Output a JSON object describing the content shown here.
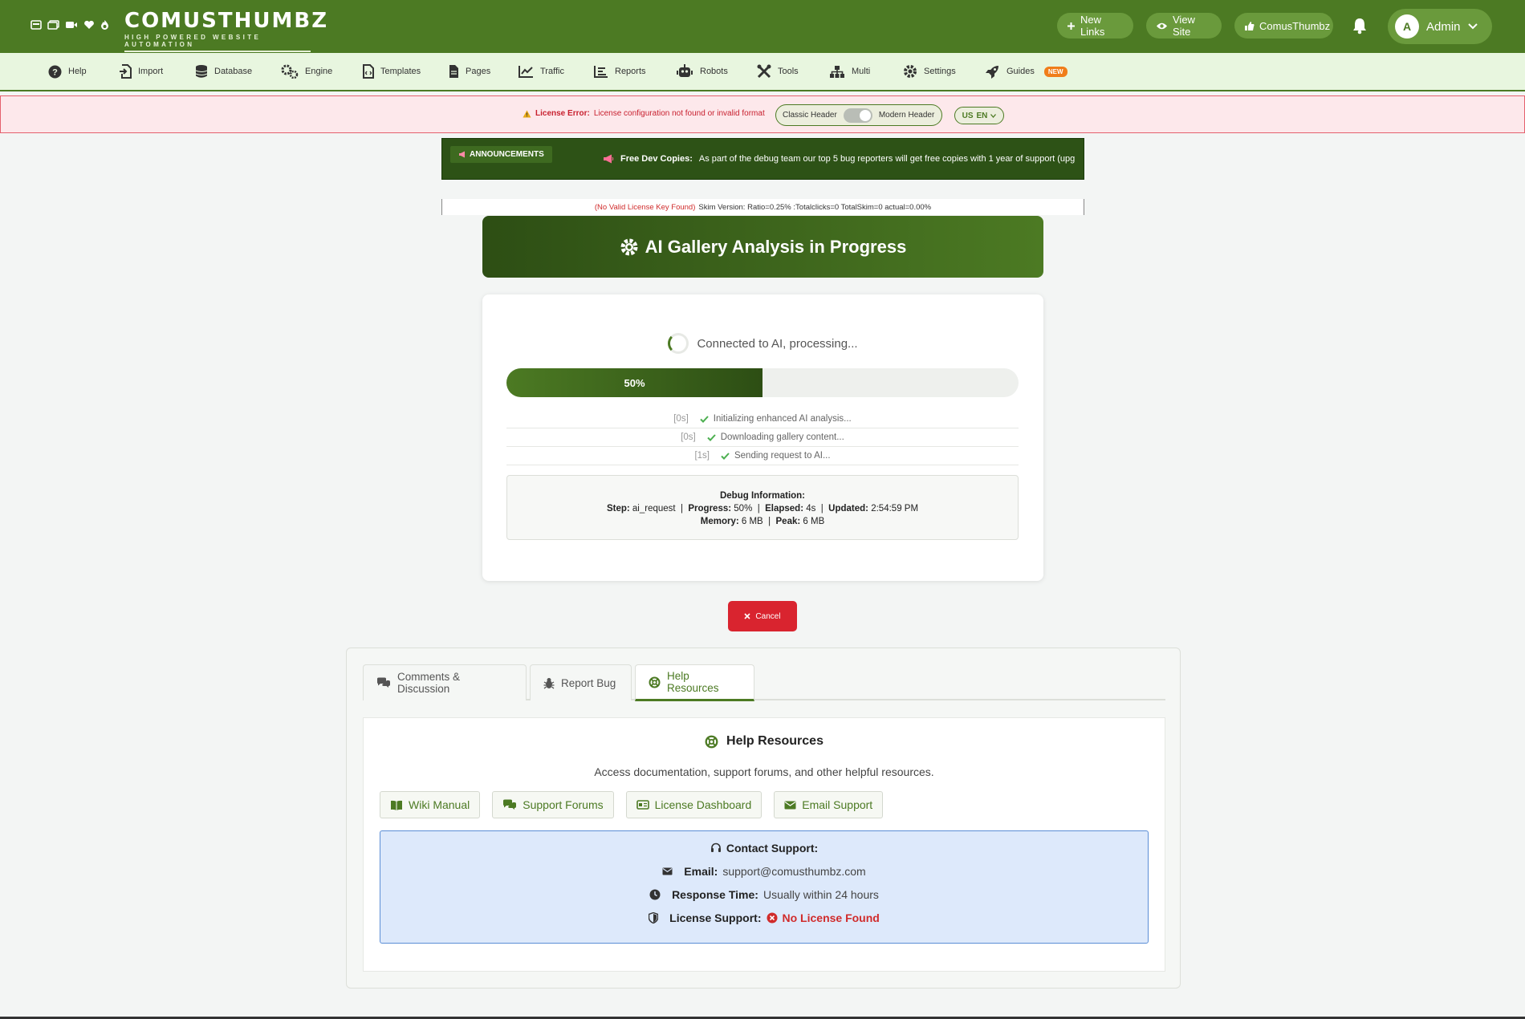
{
  "header": {
    "logo_title": "COMUSTHUMBZ",
    "logo_subtitle": "HIGH POWERED WEBSITE AUTOMATION",
    "new_links": "New Links",
    "view_site": "View Site",
    "comusthumbz": "ComusThumbz",
    "admin": "Admin",
    "avatar_letter": "A"
  },
  "nav": {
    "items": [
      {
        "label": "Help",
        "icon": "question-circle-icon"
      },
      {
        "label": "Import",
        "icon": "file-import-icon"
      },
      {
        "label": "Database",
        "icon": "database-icon"
      },
      {
        "label": "Engine",
        "icon": "gears-icon"
      },
      {
        "label": "Templates",
        "icon": "file-code-icon"
      },
      {
        "label": "Pages",
        "icon": "file-icon"
      },
      {
        "label": "Traffic",
        "icon": "line-chart-icon"
      },
      {
        "label": "Reports",
        "icon": "list-chart-icon"
      },
      {
        "label": "Robots",
        "icon": "robot-icon"
      },
      {
        "label": "Tools",
        "icon": "tools-icon"
      },
      {
        "label": "Multi",
        "icon": "sitemap-icon"
      },
      {
        "label": "Settings",
        "icon": "cog-icon"
      },
      {
        "label": "Guides",
        "icon": "rocket-icon"
      }
    ],
    "guides_badge": "NEW"
  },
  "license": {
    "label": "License Error:",
    "message": "License configuration not found or invalid format",
    "classic": "Classic Header",
    "modern": "Modern Header",
    "lang": "EN",
    "flag": "US"
  },
  "announcement": {
    "badge": "ANNOUNCEMENTS",
    "title": "Free Dev Copies:",
    "text": "As part of the debug team our top 5 bug reporters will get free copies with 1 year of support (upg"
  },
  "skim": {
    "warning": "(No Valid License Key Found)",
    "text": "Skim Version: Ratio=0.25% :Totalclicks=0 TotalSkim=0 actual=0.00%"
  },
  "analysis": {
    "title": "AI Gallery Analysis in Progress",
    "status": "Connected to AI, processing...",
    "progress": 50,
    "progress_label": "50%",
    "log": [
      {
        "time": "[0s]",
        "text": "Initializing enhanced AI analysis..."
      },
      {
        "time": "[0s]",
        "text": "Downloading gallery content..."
      },
      {
        "time": "[1s]",
        "text": "Sending request to AI..."
      }
    ],
    "debug": {
      "heading": "Debug Information:",
      "step_label": "Step:",
      "step": "ai_request",
      "progress_label": "Progress:",
      "progress": "50%",
      "elapsed_label": "Elapsed:",
      "elapsed": "4s",
      "updated_label": "Updated:",
      "updated": "2:54:59 PM",
      "memory_label": "Memory:",
      "memory": "6 MB",
      "peak_label": "Peak:",
      "peak": "6 MB"
    },
    "cancel": "Cancel"
  },
  "tabs": {
    "comments": "Comments & Discussion",
    "report": "Report Bug",
    "help": "Help Resources"
  },
  "help": {
    "title": "Help Resources",
    "desc": "Access documentation, support forums, and other helpful resources.",
    "buttons": [
      "Wiki Manual",
      "Support Forums",
      "License Dashboard",
      "Email Support"
    ],
    "contact_title": "Contact Support:",
    "email_label": "Email:",
    "email": "support@comusthumbz.com",
    "response_label": "Response Time:",
    "response": "Usually within 24 hours",
    "license_label": "License Support:",
    "license_value": "No License Found"
  },
  "colors": {
    "brand": "#4c7a23",
    "brand_dark": "#2d4e14",
    "danger": "#d9242f",
    "nav_bg": "#e8f6df"
  }
}
